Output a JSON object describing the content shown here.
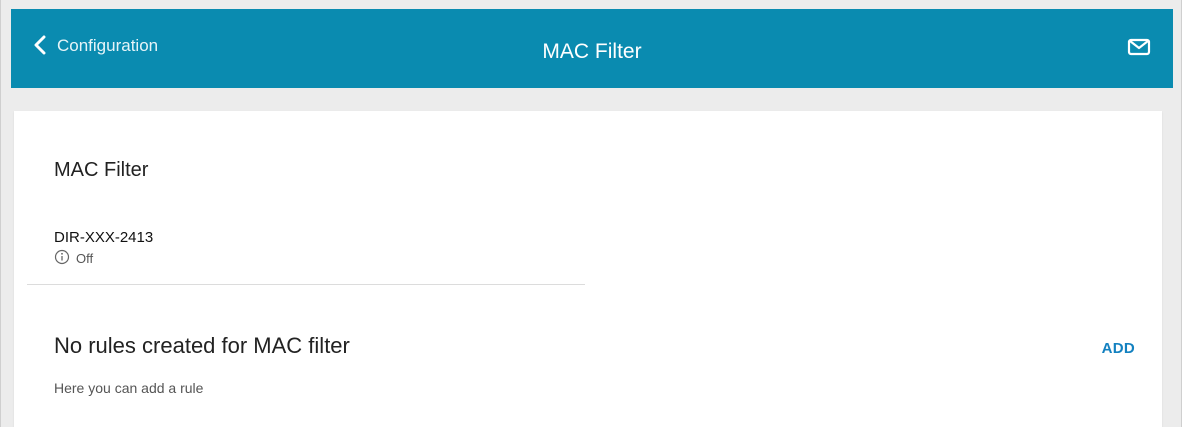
{
  "header": {
    "back_label": "Configuration",
    "title": "MAC Filter",
    "icons": {
      "back": "chevron-left-icon",
      "mail": "mail-icon"
    },
    "background_color": "#0a8bb0"
  },
  "main": {
    "section_title": "MAC Filter",
    "network": {
      "name": "DIR-XXX-2413",
      "status": "Off",
      "status_icon": "info-icon"
    },
    "rules": {
      "title": "No rules created for MAC filter",
      "hint": "Here you can add a rule",
      "add_label": "ADD",
      "add_color": "#1381c0"
    }
  }
}
